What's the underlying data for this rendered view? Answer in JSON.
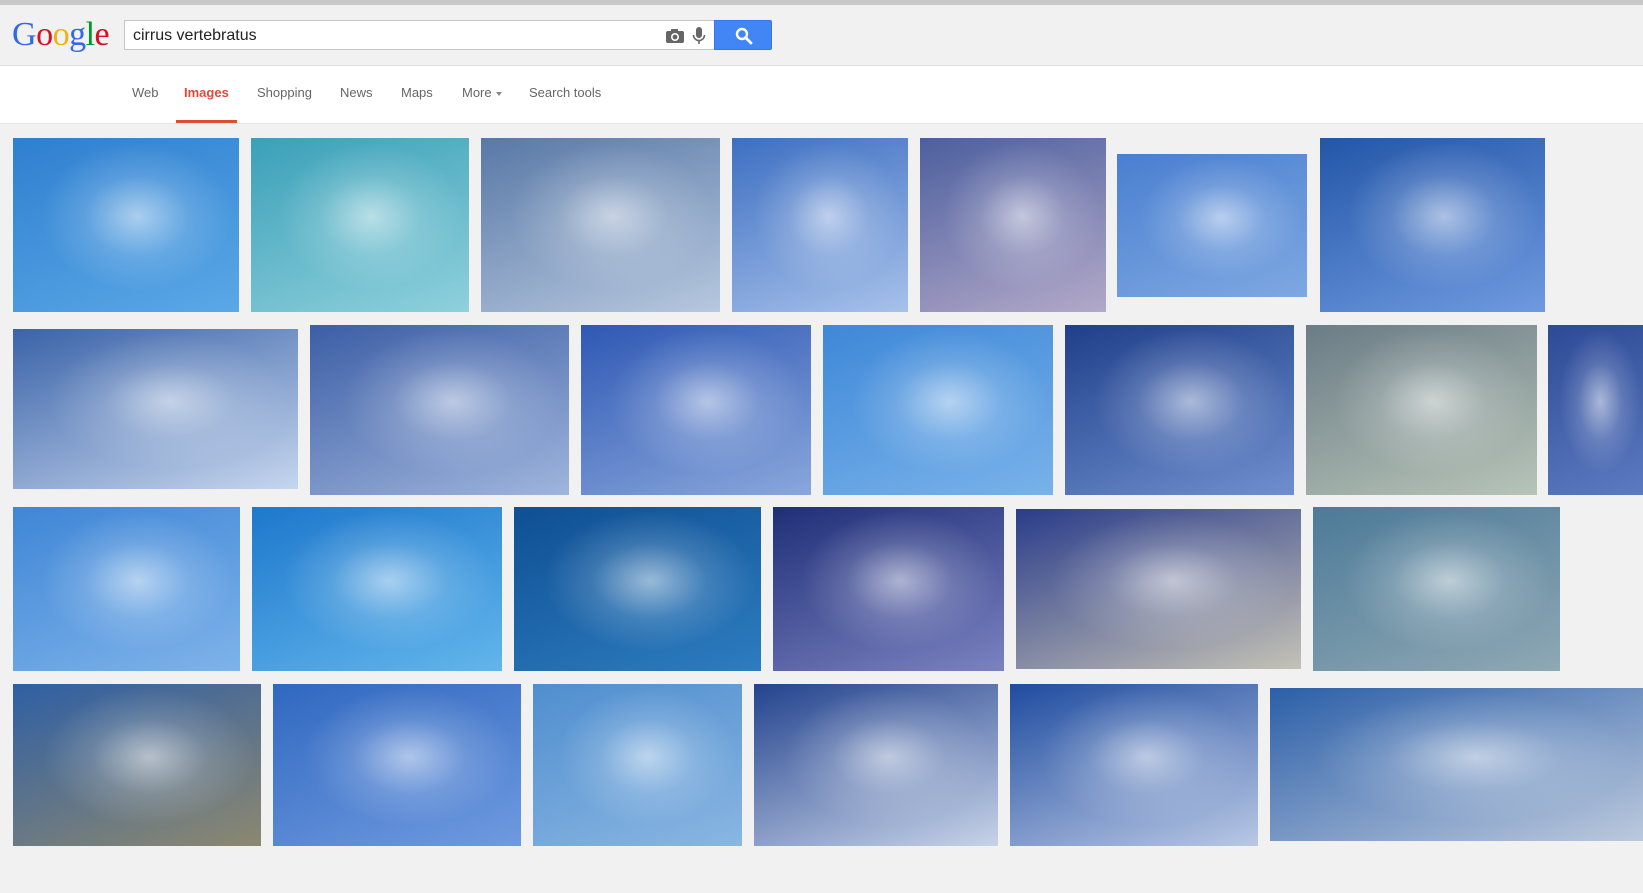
{
  "logo": {
    "letters": [
      "G",
      "o",
      "o",
      "g",
      "l",
      "e"
    ],
    "colors": [
      "#3369e8",
      "#d50f25",
      "#eeb211",
      "#3369e8",
      "#009925",
      "#d50f25"
    ]
  },
  "search": {
    "query": "cirrus vertebratus"
  },
  "icons": {
    "camera": "camera-icon",
    "mic": "microphone-icon",
    "search": "magnifier-icon"
  },
  "accent": "#dd4b39",
  "nav": {
    "web": "Web",
    "images": "Images",
    "shopping": "Shopping",
    "news": "News",
    "maps": "Maps",
    "more": "More",
    "search_tools": "Search tools"
  },
  "results": {
    "rows": [
      [
        {
          "a": "#2f7fd0",
          "b": "#5aa8e6"
        },
        {
          "a": "#3aa0b8",
          "b": "#8fd0dc"
        },
        {
          "a": "#5878a6",
          "b": "#b7c8df"
        },
        {
          "a": "#3d6fc2",
          "b": "#a7c1ea"
        },
        {
          "a": "#4c5f9e",
          "b": "#b3a9c9"
        },
        {
          "a": "#4a7fd0",
          "b": "#7ea8e2"
        },
        {
          "a": "#2356a8",
          "b": "#6f9ae0"
        }
      ],
      [
        {
          "a": "#3a63a8",
          "b": "#c6d6ee"
        },
        {
          "a": "#3c5ea6",
          "b": "#9fb5dc"
        },
        {
          "a": "#2e58b4",
          "b": "#8aa7dc"
        },
        {
          "a": "#3e88d8",
          "b": "#79b2ea"
        },
        {
          "a": "#1f3f8a",
          "b": "#6f8fcf"
        },
        {
          "a": "#6a7c86",
          "b": "#b8c4b8"
        },
        {
          "a": "#2d4a96",
          "b": "#5c7ac0"
        }
      ],
      [
        {
          "a": "#3f86d6",
          "b": "#7eb3ea"
        },
        {
          "a": "#1e78cc",
          "b": "#62b6ec"
        },
        {
          "a": "#0f4f93",
          "b": "#2d7dc0"
        },
        {
          "a": "#1f2f78",
          "b": "#7b82c0"
        },
        {
          "a": "#2a3c8a",
          "b": "#c4c2b6"
        },
        {
          "a": "#4c7a98",
          "b": "#8fa8b4"
        }
      ],
      [
        {
          "a": "#2f5fa4",
          "b": "#8c8870"
        },
        {
          "a": "#3068c0",
          "b": "#6f9ae0"
        },
        {
          "a": "#4f8ecf",
          "b": "#8ab6e2"
        },
        {
          "a": "#23438e",
          "b": "#c7d3e8"
        },
        {
          "a": "#1f4ca0",
          "b": "#b9c8e4"
        },
        {
          "a": "#2b5fa8",
          "b": "#bcc9dd"
        }
      ]
    ]
  }
}
